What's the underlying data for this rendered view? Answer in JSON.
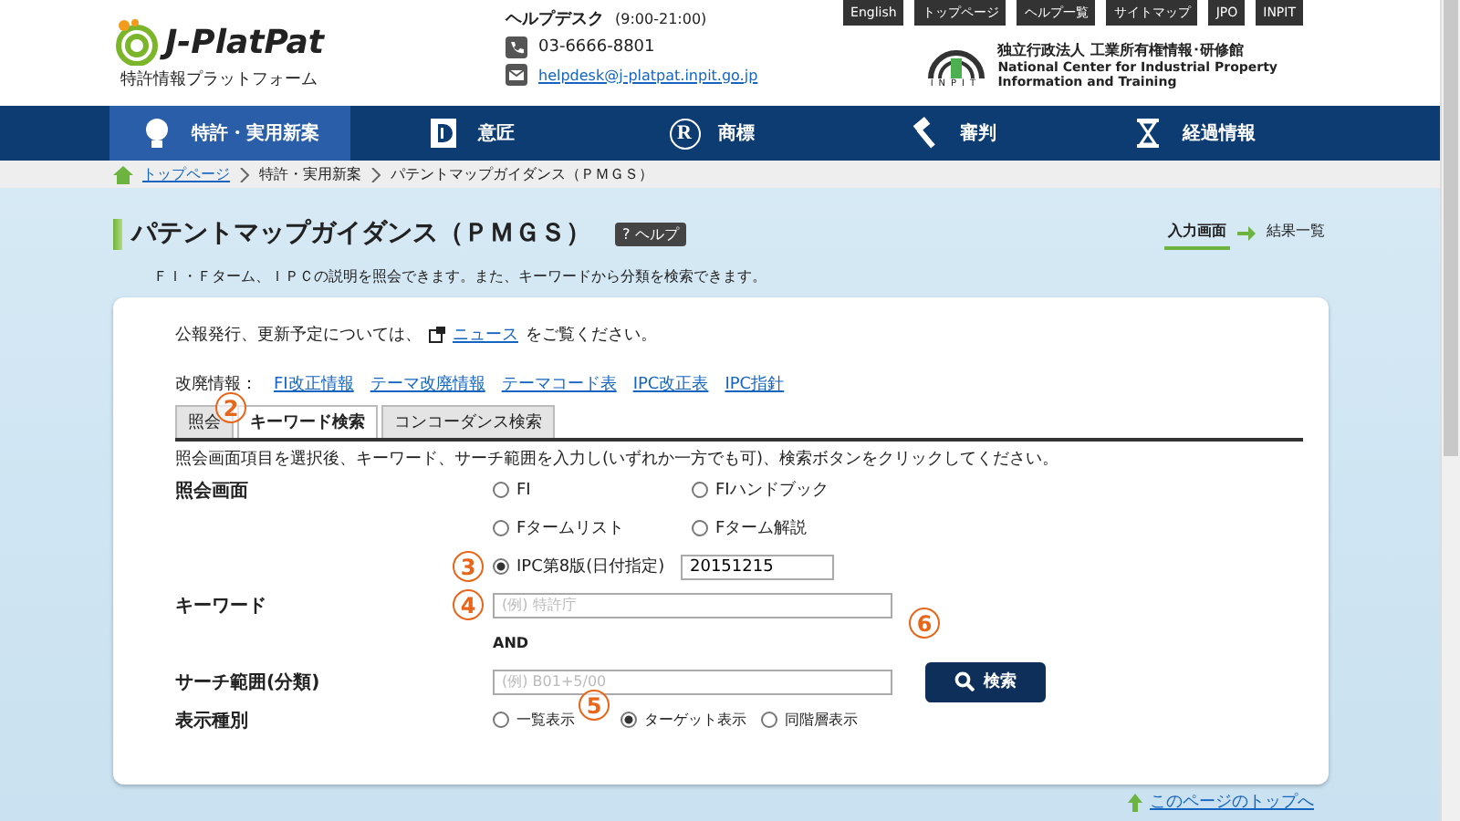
{
  "header": {
    "logo_text": "J-PlatPat",
    "logo_sub": "特許情報プラットフォーム",
    "helpdesk": {
      "title": "ヘルプデスク",
      "hours": "(9:00-21:00)",
      "phone": "03-6666-8801",
      "email": "helpdesk@j-platpat.inpit.go.jp"
    },
    "top_links": [
      "English",
      "トップページ",
      "ヘルプ一覧",
      "サイトマップ",
      "JPO",
      "INPIT"
    ],
    "org": {
      "mark": "INPIT",
      "name": "独立行政法人 工業所有権情報･研修館",
      "en_1": "National Center for Industrial Property",
      "en_2": "Information and Training"
    }
  },
  "nav": [
    {
      "label": "特許・実用新案",
      "kind": "bulb",
      "selected": true
    },
    {
      "label": "意匠",
      "kind": "design",
      "selected": false
    },
    {
      "label": "商標",
      "kind": "trademark",
      "icon_text": "R",
      "selected": false
    },
    {
      "label": "審判",
      "kind": "gavel",
      "selected": false
    },
    {
      "label": "経過情報",
      "kind": "hourglass",
      "selected": false
    }
  ],
  "breadcrumb": [
    "トップページ",
    "特許・実用新案",
    "パテントマップガイダンス（ＰＭＧＳ）"
  ],
  "page": {
    "title": "パテントマップガイダンス（ＰＭＧＳ）",
    "help": "? ヘルプ",
    "steps": [
      {
        "label": "入力画面",
        "selected": true
      },
      {
        "label": "結果一覧",
        "selected": false
      }
    ],
    "description": "ＦＩ・Ｆターム、ＩＰＣの説明を照会できます。また、キーワードから分類を検索できます。"
  },
  "notice": {
    "before": "公報発行、更新予定については、",
    "link": "ニュース",
    "after": "をご覧ください。"
  },
  "revision": {
    "label": "改廃情報：",
    "links": [
      "FI改正情報",
      "テーマ改廃情報",
      "テーマコード表",
      "IPC改正表",
      "IPC指針"
    ]
  },
  "tabs": [
    {
      "label": "照会",
      "selected": false
    },
    {
      "label": "キーワード検索",
      "selected": true
    },
    {
      "label": "コンコーダンス検索",
      "selected": false
    }
  ],
  "instruction": "照会画面項目を選択後、キーワード、サーチ範囲を入力し(いずれか一方でも可)、検索ボタンをクリックしてください。",
  "form": {
    "screen_label": "照会画面",
    "screen_options": [
      {
        "label": "FI",
        "selected": false
      },
      {
        "label": "FIハンドブック",
        "selected": false
      },
      {
        "label": "Fタームリスト",
        "selected": false
      },
      {
        "label": "Fターム解説",
        "selected": false
      },
      {
        "label": "IPC第8版(日付指定)",
        "selected": true
      }
    ],
    "date_value": "20151215",
    "keyword_label": "キーワード",
    "keyword_placeholder": "(例) 特許庁",
    "and": "AND",
    "range_label": "サーチ範囲(分類)",
    "range_placeholder": "(例) B01+5/00",
    "search_button": "検索",
    "display_label": "表示種別",
    "display_options": [
      {
        "label": "一覧表示",
        "selected": false
      },
      {
        "label": "ターゲット表示",
        "selected": true
      },
      {
        "label": "同階層表示",
        "selected": false
      }
    ]
  },
  "annotations": [
    "2",
    "3",
    "4",
    "5",
    "6"
  ],
  "footer_link": "このページのトップへ"
}
